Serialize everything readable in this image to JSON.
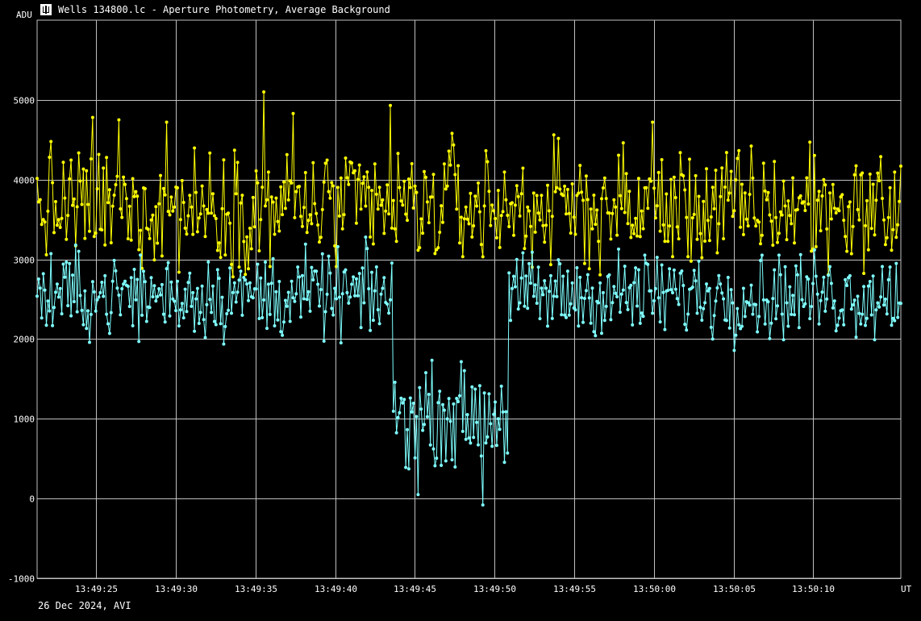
{
  "window": {
    "title": "Wells 134800.lc - Aperture Photometry, Average Background",
    "icon": "lightcurve-app-icon"
  },
  "footer": {
    "date_text": "26 Dec 2024, AVI"
  },
  "colors": {
    "background": "#000000",
    "grid": "#c0c0c0",
    "target": "#ffff00",
    "comparison": "#7fffff"
  },
  "chart_data": {
    "type": "line",
    "xlabel": "UT",
    "ylabel": "ADU",
    "xlim": [
      "13:49:21.3",
      "13:50:15.5"
    ],
    "ylim": [
      -1000,
      6000
    ],
    "y_ticks": [
      -1000,
      0,
      1000,
      2000,
      3000,
      4000,
      5000
    ],
    "x_ticks": [
      "13:49:25",
      "13:49:30",
      "13:49:35",
      "13:49:40",
      "13:49:45",
      "13:49:50",
      "13:49:55",
      "13:50:00",
      "13:50:05",
      "13:50:10"
    ],
    "grid": true,
    "series": [
      {
        "role": "target",
        "color": "#ffff00",
        "baseline": 3650,
        "noise": 450,
        "time_start": "13:49:21.3",
        "time_end": "13:50:15.5",
        "peaks": [
          {
            "t": "13:49:24.8",
            "y": 4780
          },
          {
            "t": "13:49:26.4",
            "y": 4750
          },
          {
            "t": "13:49:29.4",
            "y": 4720
          },
          {
            "t": "13:49:35.5",
            "y": 5100
          },
          {
            "t": "13:49:37.4",
            "y": 4830
          },
          {
            "t": "13:49:43.5",
            "y": 4930
          },
          {
            "t": "13:49:47.3",
            "y": 4580
          },
          {
            "t": "13:49:59.9",
            "y": 4720
          },
          {
            "t": "13:50:09.8",
            "y": 4470
          }
        ]
      },
      {
        "role": "comparison",
        "color": "#7fffff",
        "baseline": 2550,
        "noise": 330,
        "time_start": "13:49:21.3",
        "time_end": "13:50:15.5",
        "event": {
          "start": "13:49:43.6",
          "end": "13:49:50.9",
          "level": 1050,
          "noise": 360
        },
        "dips": [
          {
            "t": "13:49:45.2",
            "y": 50
          },
          {
            "t": "13:49:49.3",
            "y": -80
          }
        ]
      }
    ]
  }
}
